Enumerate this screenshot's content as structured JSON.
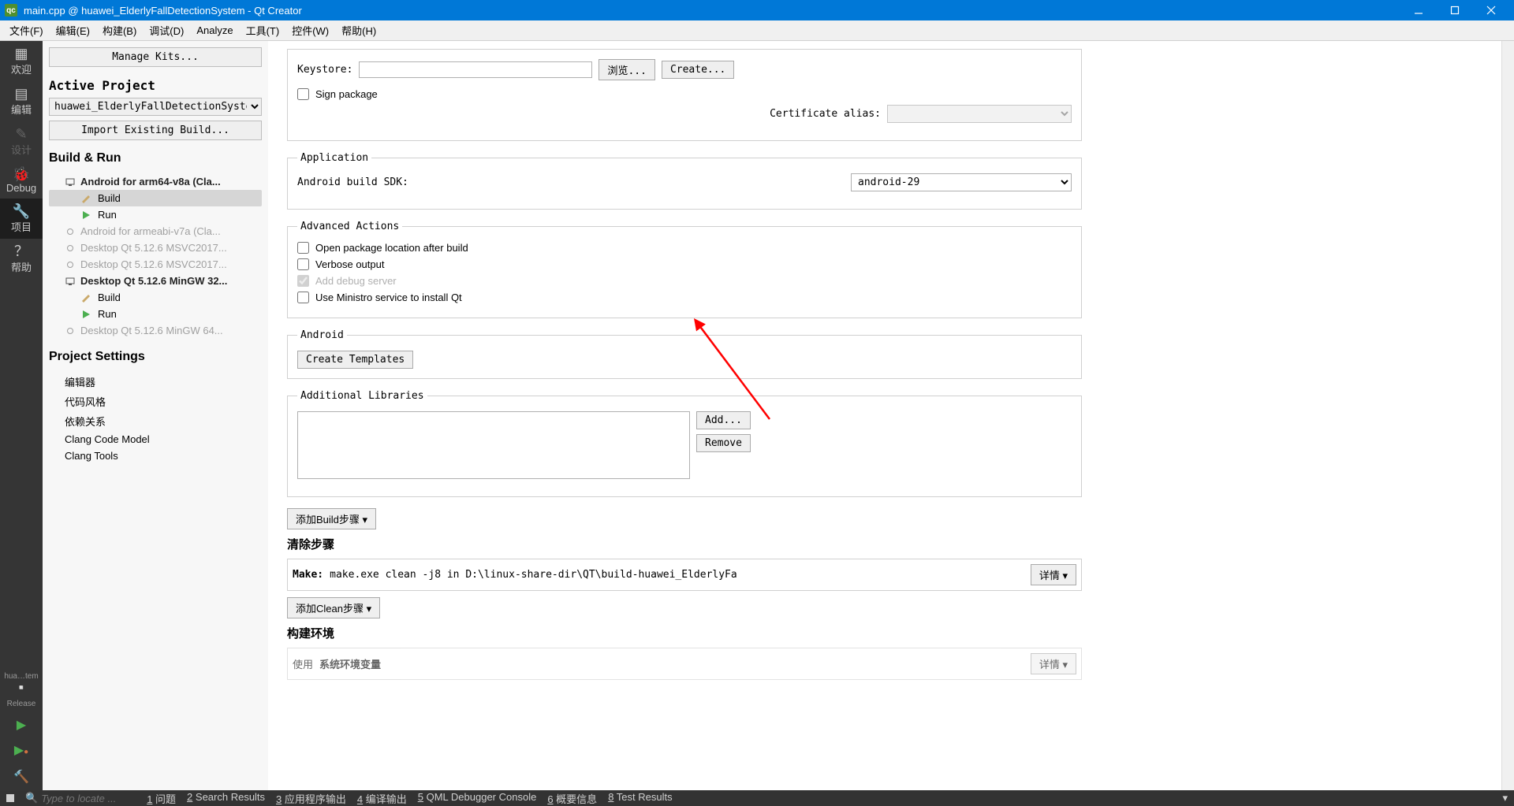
{
  "title": "main.cpp @ huawei_ElderlyFallDetectionSystem - Qt Creator",
  "menu": [
    "文件(F)",
    "编辑(E)",
    "构建(B)",
    "调试(D)",
    "Analyze",
    "工具(T)",
    "控件(W)",
    "帮助(H)"
  ],
  "vtool": {
    "items": [
      {
        "label": "欢迎",
        "name": "mode-welcome"
      },
      {
        "label": "编辑",
        "name": "mode-edit"
      },
      {
        "label": "设计",
        "name": "mode-design"
      },
      {
        "label": "Debug",
        "name": "mode-debug"
      },
      {
        "label": "项目",
        "name": "mode-projects",
        "sel": true
      },
      {
        "label": "帮助",
        "name": "mode-help"
      }
    ],
    "projTag": "hua…tem",
    "buildTag": "Release"
  },
  "sidebar": {
    "manageKits": "Manage Kits...",
    "activeProject": "Active Project",
    "projectSel": "huawei_ElderlyFallDetectionSystem",
    "importBtn": "Import Existing Build...",
    "buildRun": "Build & Run",
    "kits": [
      {
        "label": "Android for arm64-v8a (Cla...",
        "bold": true,
        "children": [
          {
            "label": "Build",
            "kind": "build",
            "sel": true
          },
          {
            "label": "Run",
            "kind": "run"
          }
        ]
      },
      {
        "label": "Android for armeabi-v7a (Cla...",
        "dim": true
      },
      {
        "label": "Desktop Qt 5.12.6 MSVC2017...",
        "dim": true
      },
      {
        "label": "Desktop Qt 5.12.6 MSVC2017...",
        "dim": true
      },
      {
        "label": "Desktop Qt 5.12.6 MinGW 32...",
        "bold": true,
        "children": [
          {
            "label": "Build",
            "kind": "build"
          },
          {
            "label": "Run",
            "kind": "run"
          }
        ]
      },
      {
        "label": "Desktop Qt 5.12.6 MinGW 64...",
        "dim": true
      }
    ],
    "projectSettings": "Project Settings",
    "psItems": [
      "编辑器",
      "代码风格",
      "依赖关系",
      "Clang Code Model",
      "Clang Tools"
    ]
  },
  "form": {
    "keystore": "Keystore:",
    "browse": "浏览...",
    "create": "Create...",
    "signPkg": "Sign package",
    "certAlias": "Certificate alias:",
    "application": "Application",
    "sdkLabel": "Android build SDK:",
    "sdkVal": "android-29",
    "advActions": "Advanced Actions",
    "openLoc": "Open package location after build",
    "verbose": "Verbose output",
    "addDebug": "Add debug server",
    "ministro": "Use Ministro service to install Qt",
    "android": "Android",
    "createTpl": "Create Templates",
    "addLibs": "Additional Libraries",
    "add": "Add...",
    "remove": "Remove",
    "addBuildStep": "添加Build步骤",
    "cleanSteps": "清除步骤",
    "make": "Make:",
    "makeCmd": "make.exe clean -j8 in D:\\linux-share-dir\\QT\\build-huawei_ElderlyFa",
    "details": "详情",
    "addCleanStep": "添加Clean步骤",
    "buildEnv": "构建环境",
    "use": "使用",
    "sysEnv": "系统环境变量"
  },
  "bottom": {
    "locate": "Type to locate ...",
    "panes": [
      {
        "n": "1",
        "t": "问题"
      },
      {
        "n": "2",
        "t": "Search Results"
      },
      {
        "n": "3",
        "t": "应用程序输出"
      },
      {
        "n": "4",
        "t": "编译输出"
      },
      {
        "n": "5",
        "t": "QML Debugger Console"
      },
      {
        "n": "6",
        "t": "概要信息"
      },
      {
        "n": "8",
        "t": "Test Results"
      }
    ]
  }
}
